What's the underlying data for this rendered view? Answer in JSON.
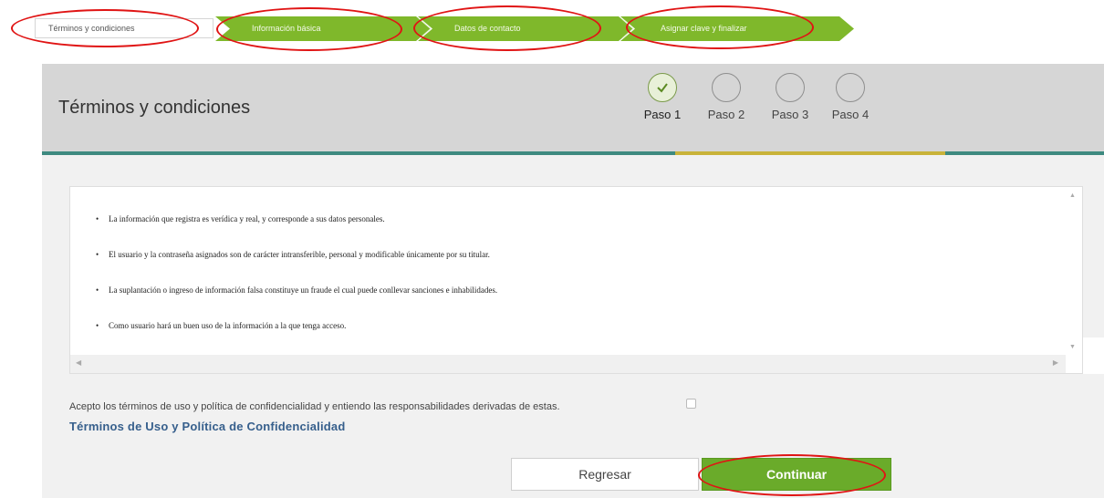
{
  "wizard_nav": {
    "steps": [
      {
        "label": "Términos y condiciones"
      },
      {
        "label": "Información básica"
      },
      {
        "label": "Datos de contacto"
      },
      {
        "label": "Asignar clave y finalizar"
      }
    ],
    "accent_color": "#7fb82b"
  },
  "panel": {
    "title": "Términos y condiciones",
    "steps": [
      {
        "label": "Paso 1",
        "state": "completed",
        "icon": "check-icon"
      },
      {
        "label": "Paso 2",
        "state": "pending"
      },
      {
        "label": "Paso 3",
        "state": "pending"
      },
      {
        "label": "Paso 4",
        "state": "pending"
      }
    ]
  },
  "terms": {
    "items": [
      "La información que registra es verídica y real, y corresponde a sus datos personales.",
      "El usuario y la contraseña asignados son de carácter intransferible, personal y modificable únicamente por su titular.",
      "La suplantación o ingreso de información falsa constituye un fraude el cual puede conllevar sanciones e inhabilidades.",
      "Como usuario hará un buen uso de la información a la que tenga acceso."
    ]
  },
  "acceptance": {
    "text": "Acepto los términos de uso y política de confidencialidad y entiendo las responsabilidades derivadas de estas.",
    "checked": false,
    "link": "Términos de Uso y Política de Confidencialidad"
  },
  "buttons": {
    "back": "Regresar",
    "continue": "Continuar"
  },
  "annotation_color": "#e01414"
}
